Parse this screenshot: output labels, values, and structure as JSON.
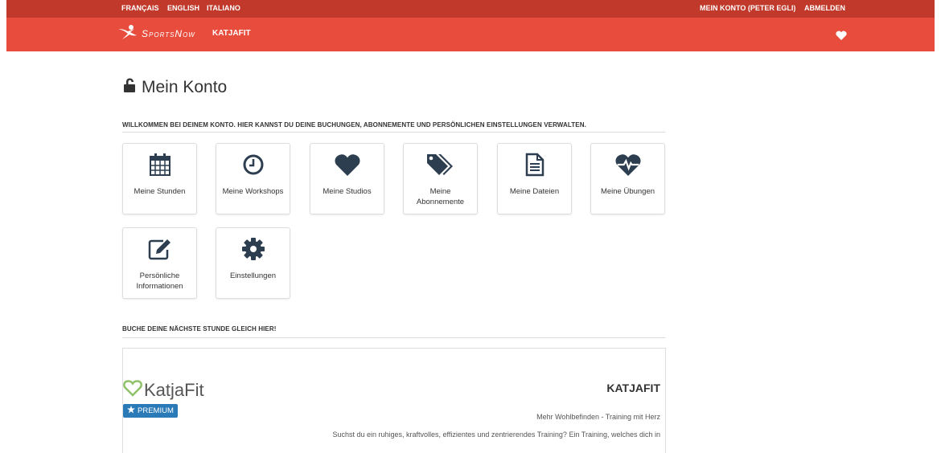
{
  "topbar": {
    "lang_fr": "FRANÇAIS",
    "lang_en": "ENGLISH",
    "lang_it": "ITALIANO",
    "account": "MEIN KONTO (PETER EGLI)",
    "logout": "ABMELDEN"
  },
  "navbar": {
    "brand": "SportsNow",
    "studio_link": "KATJAFIT",
    "icons": [
      "sportsnow-logo-icon",
      "heart-icon"
    ]
  },
  "page": {
    "title": "Mein Konto",
    "welcome": "WILLKOMMEN BEI DEINEM KONTO. HIER KANNST DU DEINE BUCHUNGEN, ABONNEMENTE UND PERSÖNLICHEN EINSTELLUNGEN VERWALTEN.",
    "book_heading": "BUCHE DEINE NÄCHSTE STUNDE GLEICH HIER!"
  },
  "tiles": [
    {
      "label": "Meine Stunden",
      "icon": "calendar-icon"
    },
    {
      "label": "Meine Workshops",
      "icon": "clock-icon"
    },
    {
      "label": "Meine Studios",
      "icon": "heart-icon"
    },
    {
      "label": "Meine Abonnemente",
      "icon": "tags-icon"
    },
    {
      "label": "Meine Dateien",
      "icon": "file-icon"
    },
    {
      "label": "Meine Übungen",
      "icon": "heartbeat-icon"
    },
    {
      "label": "Persönliche Informationen",
      "icon": "edit-icon"
    },
    {
      "label": "Einstellungen",
      "icon": "gear-icon"
    }
  ],
  "studio": {
    "logo_text": "KatjaFit",
    "badge": "PREMIUM",
    "name": "KATJAFIT",
    "tagline": "Mehr Wohlbefinden - Training mit Herz",
    "description": "Suchst du ein ruhiges, kraftvolles, effizientes und zentrierendes Training? Ein Training, welches dich in"
  },
  "colors": {
    "topbar": "#c0392b",
    "navbar": "#e74c3c",
    "icon": "#2c3e50",
    "premium": "#2a7ab8"
  }
}
